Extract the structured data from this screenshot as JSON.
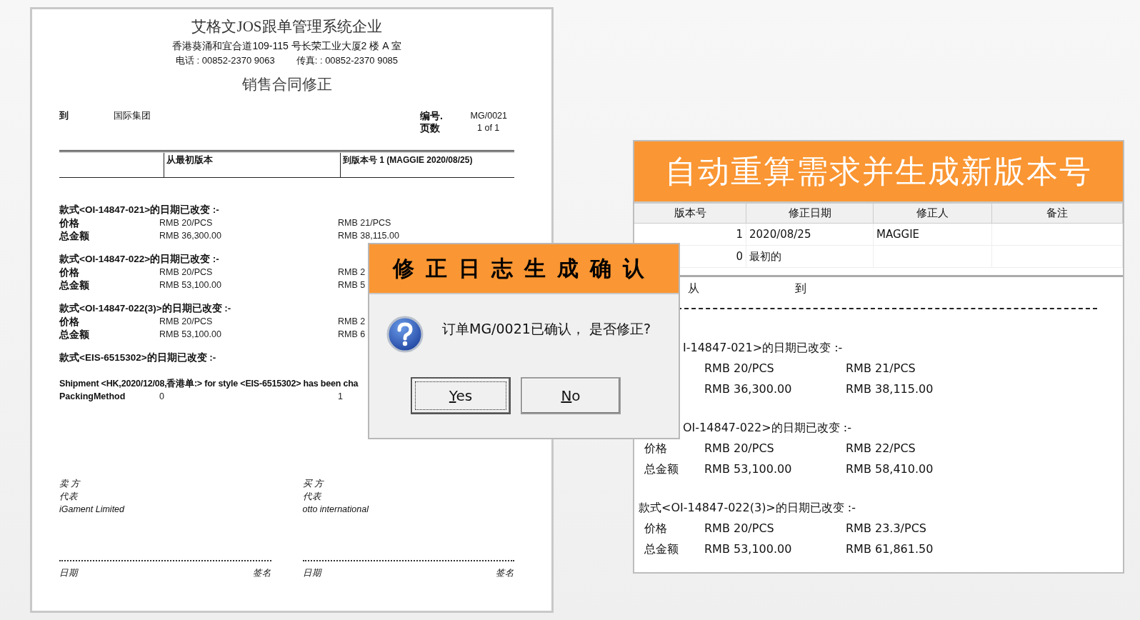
{
  "report": {
    "company": "艾格文JOS跟单管理系统企业",
    "address": "香港葵涌和宜合道109-115 号长荣工业大厦2 楼 A 室",
    "phone": "电话 : 00852-2370 9063",
    "fax": "传真: : 00852-2370 9085",
    "title": "销售合同修正",
    "to_label": "到",
    "to_value": "国际集团",
    "meta": [
      {
        "label": "编号.",
        "value": "MG/0021"
      },
      {
        "label": "页数",
        "value": "1 of 1"
      }
    ],
    "columns": [
      "从最初版本",
      "到版本号 1 (MAGGIE 2020/08/25)"
    ],
    "changes": [
      {
        "heading": "款式<OI-14847-021>的日期已改变 :-",
        "rows": [
          {
            "label": "价格",
            "from": "RMB 20/PCS",
            "to": "RMB 21/PCS"
          },
          {
            "label": "总金额",
            "from": "RMB 36,300.00",
            "to": "RMB 38,115.00"
          }
        ]
      },
      {
        "heading": "款式<OI-14847-022>的日期已改变 :-",
        "rows": [
          {
            "label": "价格",
            "from": "RMB 20/PCS",
            "to": "RMB 2"
          },
          {
            "label": "总金额",
            "from": "RMB 53,100.00",
            "to": "RMB 5"
          }
        ]
      },
      {
        "heading": "款式<OI-14847-022(3)>的日期已改变 :-",
        "rows": [
          {
            "label": "价格",
            "from": "RMB 20/PCS",
            "to": "RMB 2"
          },
          {
            "label": "总金额",
            "from": "RMB 53,100.00",
            "to": "RMB 6"
          }
        ]
      },
      {
        "heading": "款式<EIS-6515302>的日期已改变 :-"
      }
    ],
    "shipment": {
      "heading": "Shipment <HK,2020/12/08,香港单:> for style <EIS-6515302> has been cha",
      "rows": [
        {
          "label": "PackingMethod",
          "from": "0",
          "to": "1"
        }
      ]
    },
    "signatures": [
      {
        "party": "卖 方",
        "role": "代表",
        "company": "iGament Limited",
        "date_label": "日期",
        "sign_label": "签名"
      },
      {
        "party": "买 方",
        "role": "代表",
        "company": "otto international",
        "date_label": "日期",
        "sign_label": "签名"
      }
    ]
  },
  "revision_panel": {
    "banner": "自动重算需求并生成新版本号",
    "columns": [
      "版本号",
      "修正日期",
      "修正人",
      "备注"
    ],
    "rows": [
      {
        "version": "1",
        "date": "2020/08/25",
        "by": "MAGGIE"
      },
      {
        "version": "0",
        "date": "最初的"
      }
    ],
    "from_label": "从",
    "to_label": "到",
    "changes": [
      {
        "heading": "I-14847-021>的日期已改变 :-",
        "clipped": true,
        "rows": [
          {
            "from": "RMB 20/PCS",
            "to": "RMB 21/PCS"
          },
          {
            "from": "RMB 36,300.00",
            "to": "RMB 38,115.00"
          }
        ]
      },
      {
        "heading": "OI-14847-022>的日期已改变 :-",
        "clipped": true,
        "rows": [
          {
            "label": "价格",
            "from": "RMB 20/PCS",
            "to": "RMB 22/PCS"
          },
          {
            "label": "总金额",
            "from": "RMB 53,100.00",
            "to": "RMB 58,410.00"
          }
        ]
      },
      {
        "heading": "款式<OI-14847-022(3)>的日期已改变 :-",
        "clipped": false,
        "rows": [
          {
            "label": "价格",
            "from": "RMB 20/PCS",
            "to": "RMB 23.3/PCS"
          },
          {
            "label": "总金额",
            "from": "RMB 53,100.00",
            "to": "RMB 61,861.50"
          }
        ]
      }
    ]
  },
  "dialog": {
    "title": "修正日志生成确认",
    "message": "订单MG/0021已确认， 是否修正?",
    "buttons": [
      {
        "label": "Yes",
        "selected": true
      },
      {
        "label": "No",
        "selected": false
      }
    ]
  }
}
